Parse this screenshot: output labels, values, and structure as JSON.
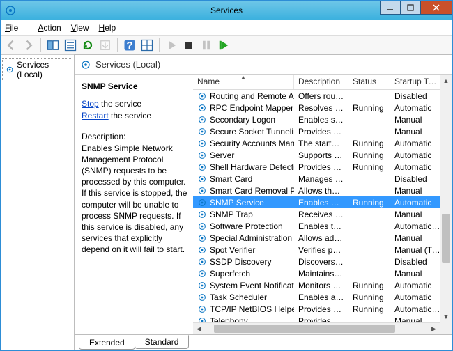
{
  "window": {
    "title": "Services"
  },
  "menu": {
    "file": "File",
    "action": "Action",
    "view": "View",
    "help": "Help"
  },
  "tree": {
    "root": "Services (Local)"
  },
  "header": {
    "title": "Services (Local)"
  },
  "columns": {
    "name": "Name",
    "description": "Description",
    "status": "Status",
    "startup": "Startup Type"
  },
  "detail": {
    "name": "SNMP Service",
    "stop": "Stop",
    "stop_after": " the service",
    "restart": "Restart",
    "restart_after": " the service",
    "desc_label": "Description:",
    "desc_text": "Enables Simple Network Management Protocol (SNMP) requests to be processed by this computer. If this service is stopped, the computer will be unable to process SNMP requests. If this service is disabled, any services that explicitly depend on it will fail to start."
  },
  "rows": [
    {
      "name": "Routing and Remote Access",
      "desc": "Offers routi...",
      "status": "",
      "startup": "Disabled"
    },
    {
      "name": "RPC Endpoint Mapper",
      "desc": "Resolves RP...",
      "status": "Running",
      "startup": "Automatic"
    },
    {
      "name": "Secondary Logon",
      "desc": "Enables star...",
      "status": "",
      "startup": "Manual"
    },
    {
      "name": "Secure Socket Tunneling Pr...",
      "desc": "Provides su...",
      "status": "",
      "startup": "Manual"
    },
    {
      "name": "Security Accounts Manager",
      "desc": "The startup ...",
      "status": "Running",
      "startup": "Automatic"
    },
    {
      "name": "Server",
      "desc": "Supports fil...",
      "status": "Running",
      "startup": "Automatic"
    },
    {
      "name": "Shell Hardware Detection",
      "desc": "Provides no...",
      "status": "Running",
      "startup": "Automatic"
    },
    {
      "name": "Smart Card",
      "desc": "Manages ac...",
      "status": "",
      "startup": "Disabled"
    },
    {
      "name": "Smart Card Removal Policy",
      "desc": "Allows the s...",
      "status": "",
      "startup": "Manual"
    },
    {
      "name": "SNMP Service",
      "desc": "Enables Sim...",
      "status": "Running",
      "startup": "Automatic",
      "selected": true
    },
    {
      "name": "SNMP Trap",
      "desc": "Receives tra...",
      "status": "",
      "startup": "Manual"
    },
    {
      "name": "Software Protection",
      "desc": "Enables the ...",
      "status": "",
      "startup": "Automatic (D..."
    },
    {
      "name": "Special Administration Con...",
      "desc": "Allows adm...",
      "status": "",
      "startup": "Manual"
    },
    {
      "name": "Spot Verifier",
      "desc": "Verifies pot...",
      "status": "",
      "startup": "Manual (Trig..."
    },
    {
      "name": "SSDP Discovery",
      "desc": "Discovers n...",
      "status": "",
      "startup": "Disabled"
    },
    {
      "name": "Superfetch",
      "desc": "Maintains a...",
      "status": "",
      "startup": "Manual"
    },
    {
      "name": "System Event Notification S...",
      "desc": "Monitors sy...",
      "status": "Running",
      "startup": "Automatic"
    },
    {
      "name": "Task Scheduler",
      "desc": "Enables a us...",
      "status": "Running",
      "startup": "Automatic"
    },
    {
      "name": "TCP/IP NetBIOS Helper",
      "desc": "Provides su...",
      "status": "Running",
      "startup": "Automatic (..."
    },
    {
      "name": "Telephony",
      "desc": "Provides Tel...",
      "status": "",
      "startup": "Manual"
    }
  ],
  "tabs": {
    "extended": "Extended",
    "standard": "Standard"
  }
}
